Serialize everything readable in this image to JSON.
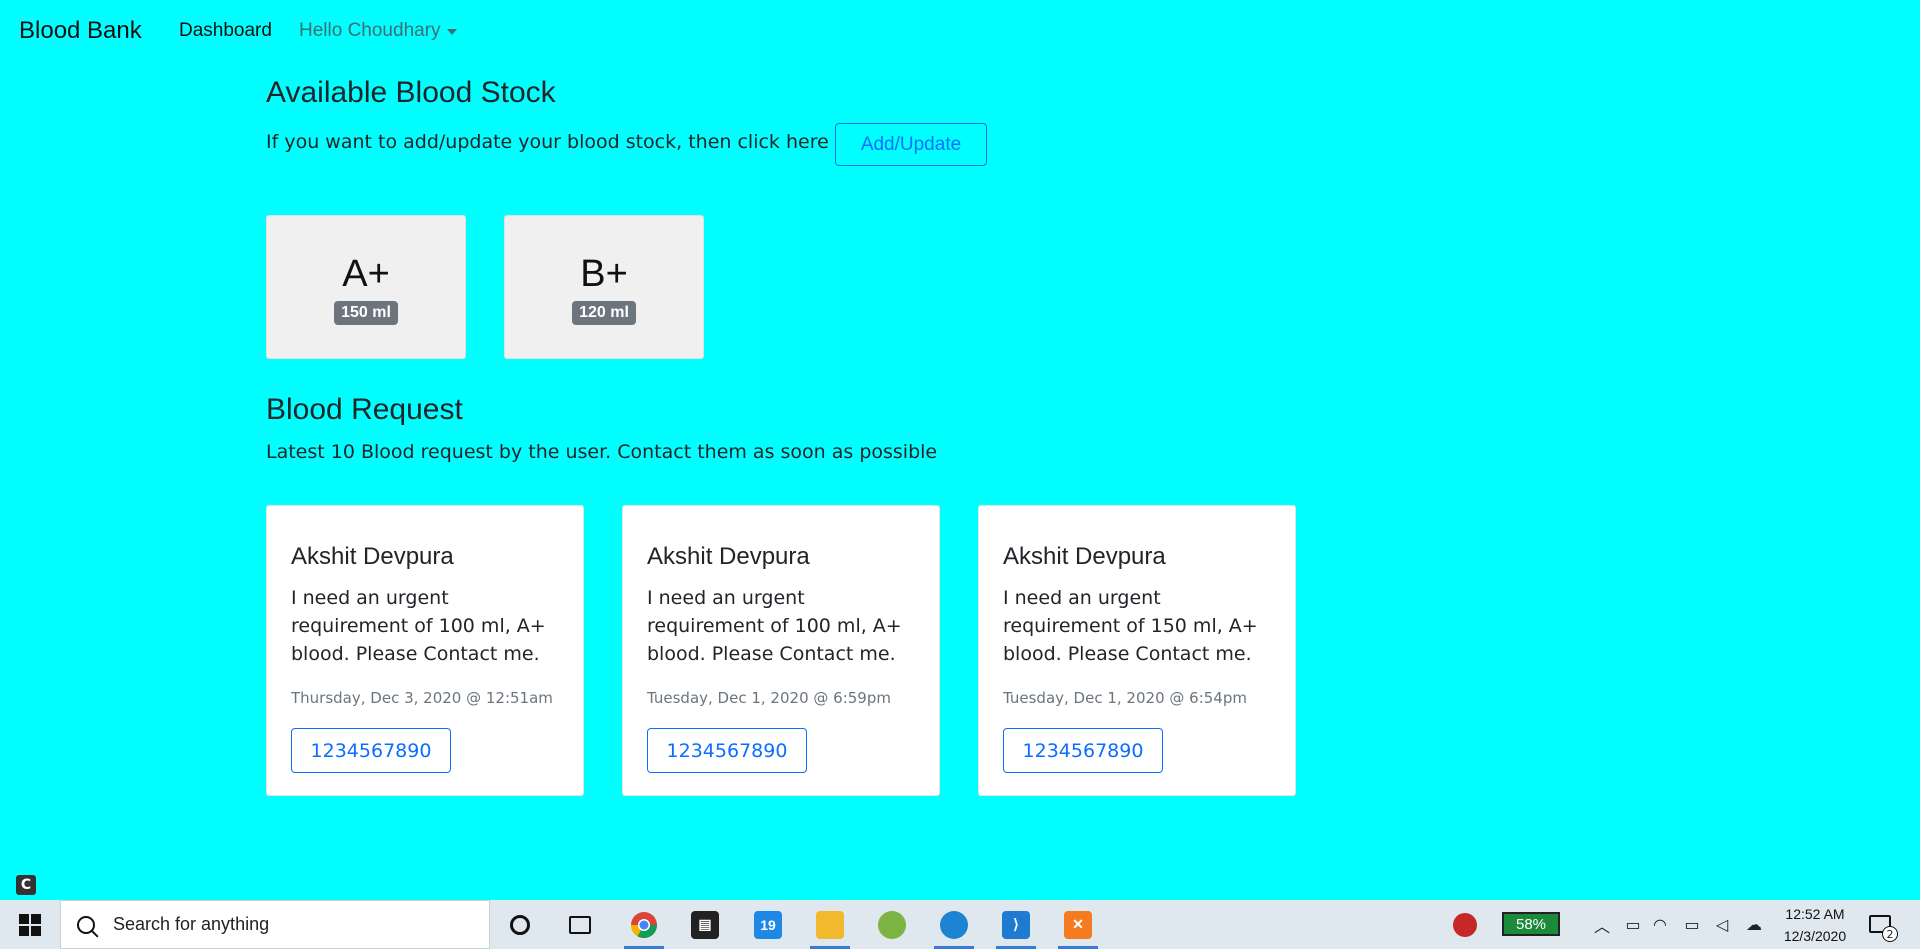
{
  "navbar": {
    "brand": "Blood Bank",
    "dashboard": "Dashboard",
    "user_menu": "Hello Choudhary"
  },
  "stock": {
    "heading": "Available Blood Stock",
    "text": "If you want to add/update your blood stock, then click here",
    "button": "Add/Update",
    "cards": [
      {
        "group": "A+",
        "amount": "150 ml"
      },
      {
        "group": "B+",
        "amount": "120 ml"
      }
    ]
  },
  "requests": {
    "heading": "Blood Request",
    "text": "Latest 10 Blood request by the user. Contact them as soon as possible",
    "cards": [
      {
        "name": "Akshit Devpura",
        "message": "I need an urgent requirement of 100 ml, A+ blood. Please Contact me.",
        "date": "Thursday, Dec 3, 2020 @ 12:51am",
        "phone": "1234567890"
      },
      {
        "name": "Akshit Devpura",
        "message": "I need an urgent requirement of 100 ml, A+ blood. Please Contact me.",
        "date": "Tuesday, Dec 1, 2020 @ 6:59pm",
        "phone": "1234567890"
      },
      {
        "name": "Akshit Devpura",
        "message": "I need an urgent requirement of 150 ml, A+ blood. Please Contact me.",
        "date": "Tuesday, Dec 1, 2020 @ 6:54pm",
        "phone": "1234567890"
      }
    ]
  },
  "taskbar": {
    "search_placeholder": "Search for anything",
    "apps": [
      {
        "icon": "chrome-icon",
        "color": "#ffffff"
      },
      {
        "icon": "store-icon",
        "color": "#222222"
      },
      {
        "icon": "calendar-19-icon",
        "label": "19",
        "color": "#1e88e5"
      },
      {
        "icon": "file-explorer-icon",
        "color": "#f2b92e"
      },
      {
        "icon": "android-studio-icon",
        "color": "#7cb342"
      },
      {
        "icon": "edge-icon",
        "color": "#1d84d4"
      },
      {
        "icon": "vscode-icon",
        "color": "#1f7ad1"
      },
      {
        "icon": "xampp-icon",
        "color": "#f47b20"
      }
    ],
    "battery": "58%",
    "time": "12:52 AM",
    "date": "12/3/2020",
    "notification_count": "2"
  },
  "misc": {
    "corner_icon_label": "C"
  }
}
